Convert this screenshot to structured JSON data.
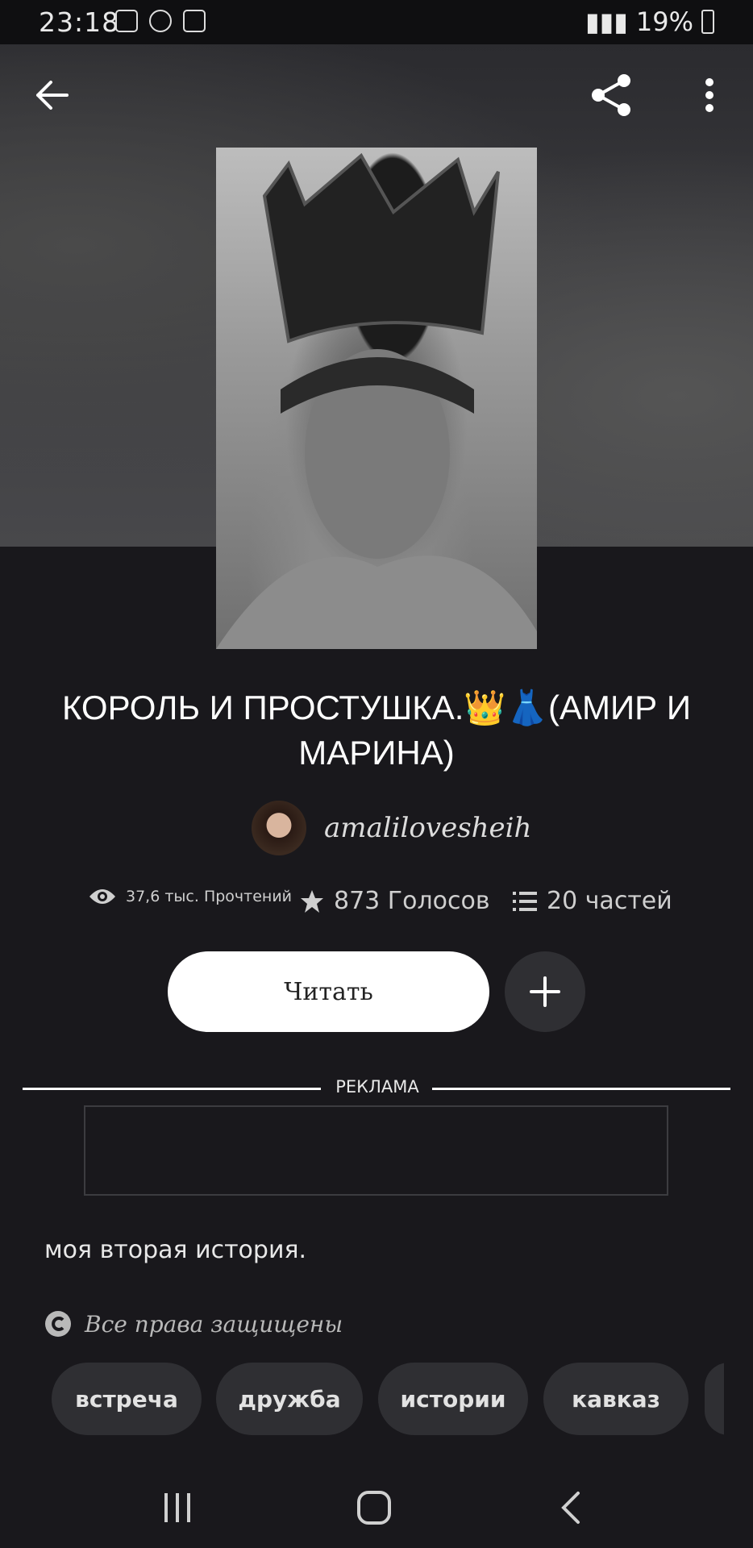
{
  "status_bar": {
    "time": "23:18",
    "battery": "19%"
  },
  "header": {
    "back": "back",
    "share": "share",
    "more": "more"
  },
  "story": {
    "title": "КОРОЛЬ И ПРОСТУШКА.👑👗(АМИР И МАРИНА)",
    "author": "amalilovesheih",
    "stats": {
      "reads": "37,6 тыс. Прочтений",
      "votes": "873 Голосов",
      "parts": "20 частей"
    },
    "read_button": "Читать",
    "ad_label": "РЕКЛАМА",
    "description": "моя вторая история.",
    "copyright": "Все права защищены",
    "tags": [
      "встреча",
      "дружба",
      "истории",
      "кавказ"
    ]
  },
  "icons": {
    "back": "arrow-left-icon",
    "share": "share-icon",
    "more": "more-vertical-icon",
    "eye": "eye-icon",
    "star": "star-icon",
    "list": "list-icon",
    "add": "plus-icon",
    "copyright": "copyright-icon"
  },
  "colors": {
    "background": "#19181c",
    "button": "#ffffff",
    "chip": "#2f2f33"
  }
}
